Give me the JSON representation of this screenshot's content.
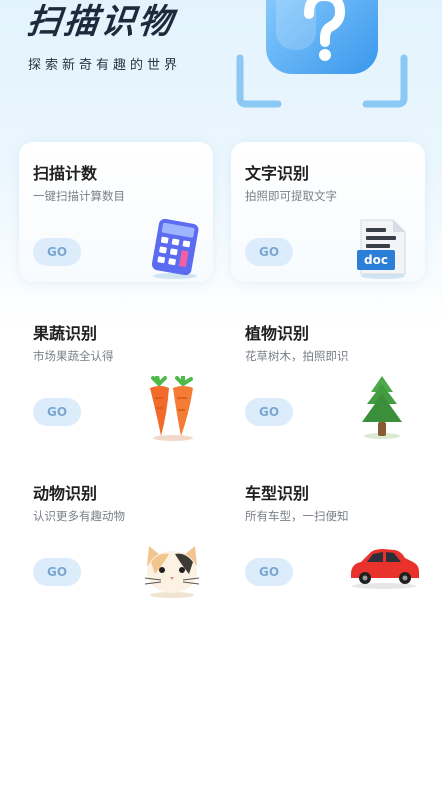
{
  "header": {
    "title": "扫描识物",
    "subtitle": "探索新奇有趣的世界",
    "graphic_icon": "question-mark-scan-icon"
  },
  "features": [
    {
      "title": "扫描计数",
      "desc": "一键扫描计算数目",
      "button": "GO",
      "icon": "calculator-icon"
    },
    {
      "title": "文字识别",
      "desc": "拍照即可提取文字",
      "button": "GO",
      "icon": "document-icon",
      "icon_label": "doc"
    },
    {
      "title": "果蔬识别",
      "desc": "市场果蔬全认得",
      "button": "GO",
      "icon": "carrot-icon"
    },
    {
      "title": "植物识别",
      "desc": "花草树木，拍照即识",
      "button": "GO",
      "icon": "tree-icon"
    },
    {
      "title": "动物识别",
      "desc": "认识更多有趣动物",
      "button": "GO",
      "icon": "cat-icon"
    },
    {
      "title": "车型识别",
      "desc": "所有车型，一扫便知",
      "button": "GO",
      "icon": "car-icon"
    }
  ],
  "colors": {
    "accent": "#dcecfa",
    "button_text": "#7ba8d2",
    "title_text": "#1c2a3c",
    "scan_blue": "#4aa8f0"
  }
}
